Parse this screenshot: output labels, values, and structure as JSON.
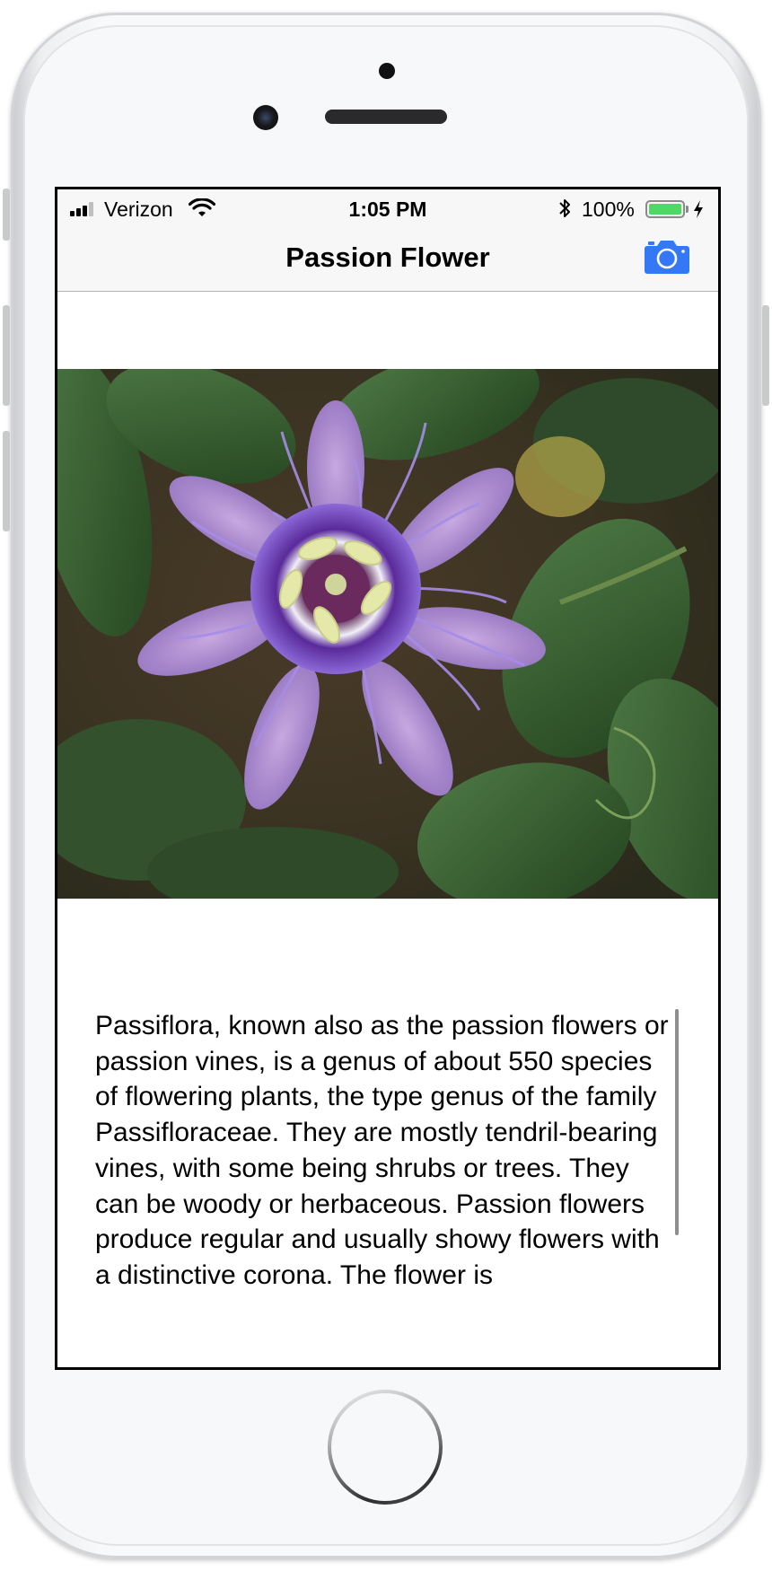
{
  "status_bar": {
    "carrier": "Verizon",
    "time": "1:05 PM",
    "battery_percent": "100%",
    "battery_level": 1.0,
    "battery_color": "#4cd964"
  },
  "nav_bar": {
    "title": "Passion Flower",
    "right_icon": "camera-icon",
    "accent_color": "#3478f6"
  },
  "content": {
    "image_subject": "passion-flower-photo",
    "description": "Passiflora, known also as the passion flowers or passion vines, is a genus of about 550 species of flowering plants, the type genus of the family Passifloraceae. They are mostly tendril-bearing vines, with some being shrubs or trees. They can be woody or herbaceous. Passion flowers produce regular and usually showy flowers with a distinctive corona. The flower is"
  }
}
